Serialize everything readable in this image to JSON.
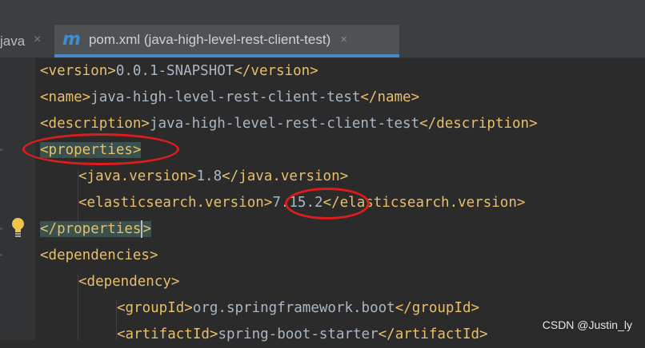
{
  "tabs": [
    {
      "label": "java",
      "close": "×"
    },
    {
      "label": "pom.xml (java-high-level-rest-client-test)",
      "icon": "m",
      "close": "×"
    }
  ],
  "code": {
    "version_open": "<version>",
    "version_val": "0.0.1-SNAPSHOT",
    "version_close": "</version>",
    "name_open": "<name>",
    "name_val": "java-high-level-rest-client-test",
    "name_close": "</name>",
    "desc_open": "<description>",
    "desc_val": "java-high-level-rest-client-test",
    "desc_close": "</description>",
    "props_open": "<properties>",
    "java_open": "<java.version>",
    "java_val": "1.8",
    "java_close": "</java.version>",
    "es_open": "<elasticsearch.version>",
    "es_val": "7.15.2",
    "es_close": "</elasticsearch.version>",
    "props_close_a": "</properties",
    "props_close_b": ">",
    "deps_open": "<dependencies>",
    "dep_open": "<dependency>",
    "group_open": "<groupId>",
    "group_val": "org.springframework.boot",
    "group_close": "</groupId>",
    "artifact_open": "<artifactId>",
    "artifact_val": "spring-boot-starter",
    "artifact_close": "</artifactId>"
  },
  "watermark": "CSDN @Justin_ly",
  "colors": {
    "tag": "#e8bf6a",
    "text": "#a9b7c6",
    "background": "#2b2b2b",
    "annotation": "#e01b1b"
  }
}
